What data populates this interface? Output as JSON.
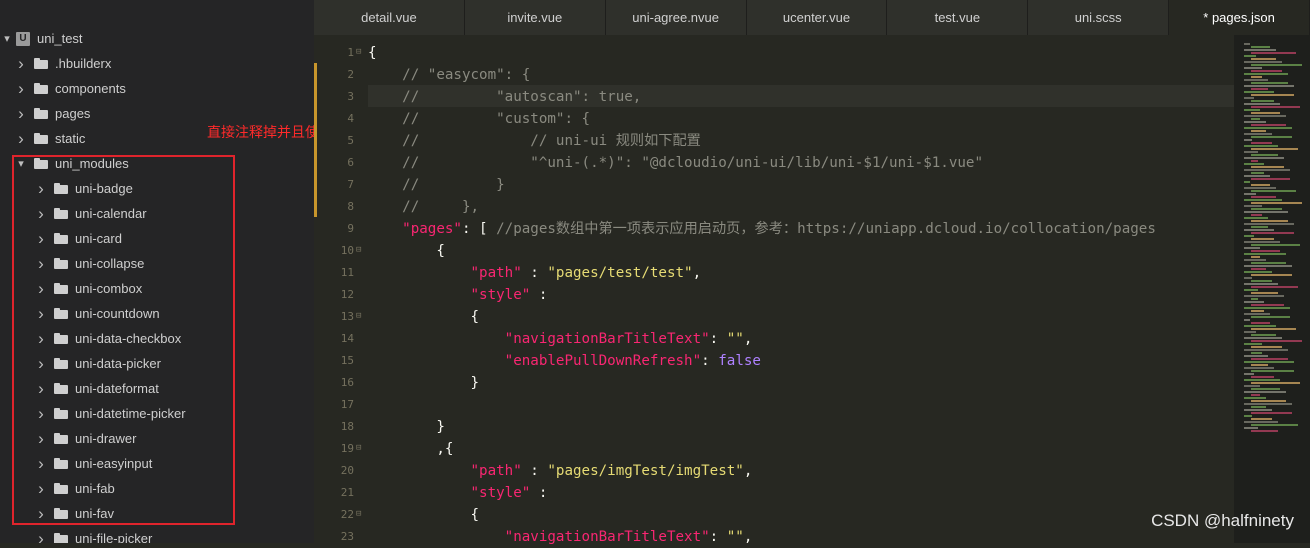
{
  "sidebar": {
    "root": {
      "label": "uni_test",
      "icon": "U"
    },
    "items": [
      {
        "label": ".hbuilderx",
        "level": 1
      },
      {
        "label": "components",
        "level": 1
      },
      {
        "label": "pages",
        "level": 1
      },
      {
        "label": "static",
        "level": 1
      },
      {
        "label": "uni_modules",
        "level": 1,
        "expanded": true
      },
      {
        "label": "uni-badge",
        "level": 2
      },
      {
        "label": "uni-calendar",
        "level": 2
      },
      {
        "label": "uni-card",
        "level": 2
      },
      {
        "label": "uni-collapse",
        "level": 2
      },
      {
        "label": "uni-combox",
        "level": 2
      },
      {
        "label": "uni-countdown",
        "level": 2
      },
      {
        "label": "uni-data-checkbox",
        "level": 2
      },
      {
        "label": "uni-data-picker",
        "level": 2
      },
      {
        "label": "uni-dateformat",
        "level": 2
      },
      {
        "label": "uni-datetime-picker",
        "level": 2
      },
      {
        "label": "uni-drawer",
        "level": 2
      },
      {
        "label": "uni-easyinput",
        "level": 2
      },
      {
        "label": "uni-fab",
        "level": 2
      },
      {
        "label": "uni-fav",
        "level": 2
      },
      {
        "label": "uni-file-picker",
        "level": 2
      }
    ]
  },
  "annotation": "直接注释掉并且使用导入uni_modules的方法",
  "tabs": [
    "detail.vue",
    "invite.vue",
    "uni-agree.nvue",
    "ucenter.vue",
    "test.vue",
    "uni.scss",
    "* pages.json"
  ],
  "editor": {
    "line_numbers": [
      "1",
      "2",
      "3",
      "4",
      "5",
      "6",
      "7",
      "8",
      "9",
      "10",
      "11",
      "12",
      "13",
      "14",
      "15",
      "16",
      "17",
      "18",
      "19",
      "20",
      "21",
      "22",
      "23"
    ],
    "lines": [
      [
        {
          "t": "{",
          "c": "p"
        }
      ],
      [
        {
          "t": "    // \"easycom\": {",
          "c": "c"
        }
      ],
      [
        {
          "t": "    //         \"autoscan\": true,",
          "c": "c"
        }
      ],
      [
        {
          "t": "    //         \"custom\": {",
          "c": "c"
        }
      ],
      [
        {
          "t": "    //             // uni-ui 规则如下配置",
          "c": "c"
        }
      ],
      [
        {
          "t": "    //             \"^uni-(.*)\": \"@dcloudio/uni-ui/lib/uni-$1/uni-$1.vue\"",
          "c": "c"
        }
      ],
      [
        {
          "t": "    //         }",
          "c": "c"
        }
      ],
      [
        {
          "t": "    //     },",
          "c": "c"
        }
      ],
      [
        {
          "t": "    ",
          "c": "p"
        },
        {
          "t": "\"pages\"",
          "c": "k"
        },
        {
          "t": ": [ ",
          "c": "p"
        },
        {
          "t": "//pages数组中第一项表示应用启动页，参考：https://uniapp.dcloud.io/collocation/pages",
          "c": "c"
        }
      ],
      [
        {
          "t": "        {",
          "c": "p"
        }
      ],
      [
        {
          "t": "            ",
          "c": "p"
        },
        {
          "t": "\"path\"",
          "c": "k"
        },
        {
          "t": " : ",
          "c": "p"
        },
        {
          "t": "\"pages/test/test\"",
          "c": "s"
        },
        {
          "t": ",",
          "c": "p"
        }
      ],
      [
        {
          "t": "            ",
          "c": "p"
        },
        {
          "t": "\"style\"",
          "c": "k"
        },
        {
          "t": " :",
          "c": "p"
        }
      ],
      [
        {
          "t": "            {",
          "c": "p"
        }
      ],
      [
        {
          "t": "                ",
          "c": "p"
        },
        {
          "t": "\"navigationBarTitleText\"",
          "c": "k"
        },
        {
          "t": ": ",
          "c": "p"
        },
        {
          "t": "\"\"",
          "c": "s"
        },
        {
          "t": ",",
          "c": "p"
        }
      ],
      [
        {
          "t": "                ",
          "c": "p"
        },
        {
          "t": "\"enablePullDownRefresh\"",
          "c": "k"
        },
        {
          "t": ": ",
          "c": "p"
        },
        {
          "t": "false",
          "c": "b"
        }
      ],
      [
        {
          "t": "            }",
          "c": "p"
        }
      ],
      [
        {
          "t": "",
          "c": "p"
        }
      ],
      [
        {
          "t": "        }",
          "c": "p"
        }
      ],
      [
        {
          "t": "        ,{",
          "c": "p"
        }
      ],
      [
        {
          "t": "            ",
          "c": "p"
        },
        {
          "t": "\"path\"",
          "c": "k"
        },
        {
          "t": " : ",
          "c": "p"
        },
        {
          "t": "\"pages/imgTest/imgTest\"",
          "c": "s"
        },
        {
          "t": ",",
          "c": "p"
        }
      ],
      [
        {
          "t": "            ",
          "c": "p"
        },
        {
          "t": "\"style\"",
          "c": "k"
        },
        {
          "t": " :",
          "c": "p"
        }
      ],
      [
        {
          "t": "            {",
          "c": "p"
        }
      ],
      [
        {
          "t": "                ",
          "c": "p"
        },
        {
          "t": "\"navigationBarTitleText\"",
          "c": "k"
        },
        {
          "t": ": ",
          "c": "p"
        },
        {
          "t": "\"\"",
          "c": "s"
        },
        {
          "t": ",",
          "c": "p"
        }
      ]
    ],
    "fold_lines": [
      1,
      10,
      13,
      19,
      22
    ]
  },
  "colors": {
    "keyword": "#f92672",
    "string": "#e6db74",
    "boolean": "#ae81ff",
    "comment": "#8a8a80",
    "annotation": "#ff2a2a"
  },
  "watermark": "CSDN @halfninety"
}
